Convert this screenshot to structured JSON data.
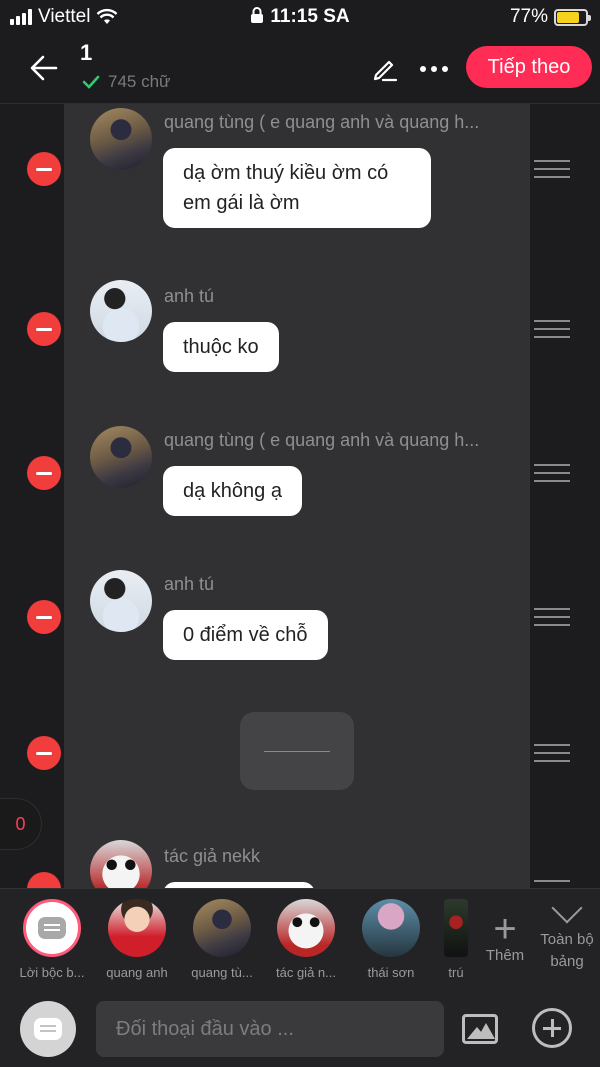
{
  "status_bar": {
    "carrier": "Viettel",
    "time": "11:15 SA",
    "battery": "77%",
    "battery_level": 0.77
  },
  "header": {
    "title": "1",
    "word_count": "745 chữ",
    "next_label": "Tiếp theo"
  },
  "messages": [
    {
      "sender": "quang tùng ( e quang anh và quang h...",
      "text": "dạ ờm thuý kiều ờm có em gái là ờm",
      "avatar": "quang-tung"
    },
    {
      "sender": "anh tú",
      "text": "thuộc ko",
      "avatar": "anh-tu"
    },
    {
      "sender": "quang tùng ( e quang anh và quang h...",
      "text": "dạ không ạ",
      "avatar": "quang-tung"
    },
    {
      "sender": "anh tú",
      "text": "0 điểm về chỗ",
      "avatar": "anh-tu"
    },
    {
      "sender": "",
      "text": "",
      "avatar": ""
    },
    {
      "sender": "tác giả nekk",
      "text": "",
      "avatar": "tac-gia"
    }
  ],
  "counter": "0",
  "characters": [
    {
      "name": "Lời bộc b...",
      "icon": "narrator-bubble-icon"
    },
    {
      "name": "quang anh",
      "icon": "avatar"
    },
    {
      "name": "quang tù...",
      "icon": "avatar"
    },
    {
      "name": "tác giả n...",
      "icon": "avatar"
    },
    {
      "name": "thái sơn",
      "icon": "avatar"
    },
    {
      "name": "trú",
      "icon": "avatar"
    }
  ],
  "add_more_label": "Thêm",
  "whole_board_label": "Toàn bộ bảng",
  "input": {
    "placeholder": "Đối thoại đầu vào ..."
  },
  "colors": {
    "accent": "#ff2c55",
    "remove": "#f23d3d",
    "panel": "#313133",
    "background": "#1c1c1e"
  }
}
